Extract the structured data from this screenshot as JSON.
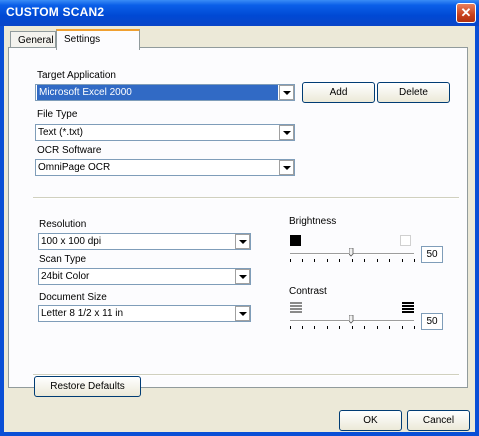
{
  "window": {
    "title": "CUSTOM SCAN2",
    "close_glyph": "✕"
  },
  "tabs": [
    {
      "label": "General"
    },
    {
      "label": "Settings"
    }
  ],
  "target_application": {
    "label": "Target Application",
    "value": "Microsoft Excel 2000"
  },
  "buttons": {
    "add": "Add",
    "delete": "Delete",
    "restore": "Restore Defaults",
    "ok": "OK",
    "cancel": "Cancel"
  },
  "file_type": {
    "label": "File Type",
    "value": "Text (*.txt)"
  },
  "ocr_software": {
    "label": "OCR Software",
    "value": "OmniPage OCR"
  },
  "resolution": {
    "label": "Resolution",
    "value": "100 x 100 dpi"
  },
  "scan_type": {
    "label": "Scan Type",
    "value": "24bit Color"
  },
  "document_size": {
    "label": "Document Size",
    "value": "Letter 8 1/2 x 11 in"
  },
  "brightness": {
    "label": "Brightness",
    "value": "50"
  },
  "contrast": {
    "label": "Contrast",
    "value": "50"
  },
  "colors": {
    "title_bar": "#0a4fd6",
    "dialog_bg": "#ece9d8",
    "selection": "#316ac5",
    "close_button": "#c8401c"
  },
  "icons": [
    "close-icon",
    "dropdown-arrow-icon",
    "black-square-icon",
    "white-square-icon",
    "low-contrast-icon",
    "high-contrast-icon"
  ]
}
